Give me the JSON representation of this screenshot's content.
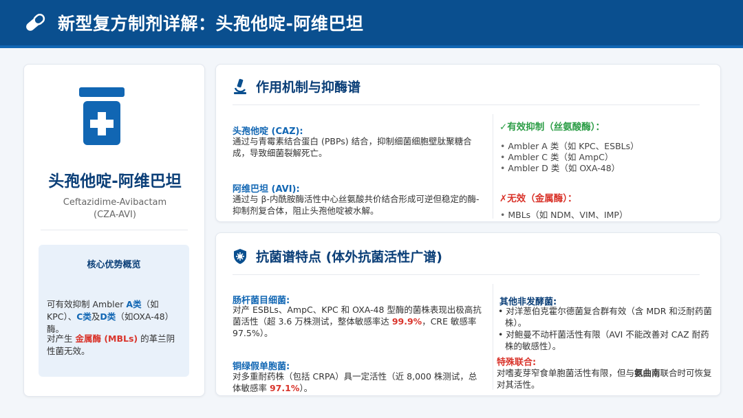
{
  "header": {
    "title": "新型复方制剂详解：头孢他啶-阿维巴坦",
    "icon": "pill-capsule-icon",
    "bg_color": "#0a4f8f"
  },
  "left": {
    "icon": "medicine-bottle-icon",
    "drug_name": "头孢他啶-阿维巴坦",
    "drug_en": "Ceftazidime-Avibactam",
    "drug_abbr": "(CZA-AVI)",
    "advantages": {
      "title": "核心优势概览",
      "p1_a": "可有效抑制 Ambler ",
      "p1_b": "A类",
      "p1_c": "（如KPC）、",
      "p1_d": "C类",
      "p1_e": "及",
      "p1_f": "D类",
      "p1_g": "（如OXA-48）酶。",
      "p2_a": "对产生 ",
      "p2_b": "金属酶 (MBLs)",
      "p2_c": " 的革兰阴性菌无效。"
    }
  },
  "mechanism": {
    "icon": "microscope-icon",
    "title": "作用机制与抑酶谱",
    "caz_title": "头孢他啶 (CAZ):",
    "caz_text": "通过与青霉素结合蛋白 (PBPs) 结合，抑制细菌细胞壁肽聚糖合成，导致细菌裂解死亡。",
    "avi_title": "阿维巴坦 (AVI):",
    "avi_text": "通过与 β-内酰胺酶活性中心丝氨酸共价结合形成可逆但稳定的酶-抑制剂复合体，阻止头孢他啶被水解。",
    "effective_title": "✓有效抑制（丝氨酸酶）：",
    "effective_items": [
      "Ambler A 类（如 KPC、ESBLs）",
      "Ambler C 类（如 AmpC）",
      "Ambler D 类（如 OXA-48）"
    ],
    "ineffective_title": "✗无效（金属酶）：",
    "ineffective_items": [
      "MBLs（如 NDM、VIM、IMP）"
    ],
    "effective_color": "#2e9e48",
    "ineffective_color": "#d9342b"
  },
  "spectrum": {
    "icon": "shield-virus-icon",
    "title": "抗菌谱特点 (体外抗菌活性广谱)",
    "entero_title": "肠杆菌目细菌:",
    "entero_a": "对产 ESBLs、AmpC、KPC 和 OXA-48 型酶的菌株表现出极高抗菌活性（超 3.6 万株测试，整体敏感率达 ",
    "entero_b": "99.9%",
    "entero_c": "，CRE 敏感率 97.5%）。",
    "pseudo_title": "铜绿假单胞菌:",
    "pseudo_a": "对多重耐药株（包括 CRPA）具一定活性（近 8,000 株测试，总体敏感率 ",
    "pseudo_b": "97.1%",
    "pseudo_c": "）。",
    "nonferm_title": "其他非发酵菌:",
    "nonferm_items": [
      "对洋葱伯克霍尔德菌复合群有效（含 MDR 和泛耐药菌株）。",
      "对鲍曼不动杆菌活性有限（AVI 不能改善对 CAZ 耐药株的敏感性）。"
    ],
    "special_title": "特殊联合:",
    "special_a": "对嗜麦芽窄食单胞菌活性有限，但与",
    "special_b": "氨曲南",
    "special_c": "联合时可恢复对其活性。"
  }
}
